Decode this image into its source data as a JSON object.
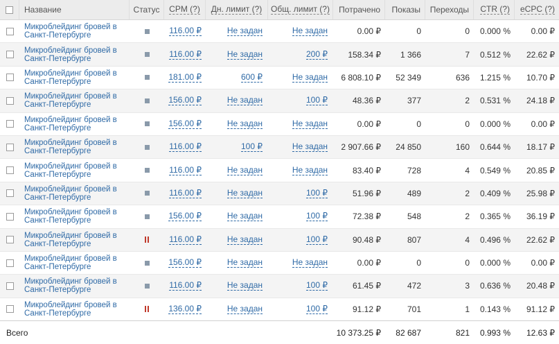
{
  "header": {
    "name": "Название",
    "status": "Статус",
    "cpm": "CPM (?)",
    "daily_limit": "Дн. лимит (?)",
    "total_limit": "Общ. лимит (?)",
    "spent": "Потрачено",
    "views": "Показы",
    "clicks": "Переходы",
    "ctr": "CTR (?)",
    "ecpc": "eCPC (?)"
  },
  "rows": [
    {
      "name": "Микроблейдинг бровей в Санкт-Петербурге",
      "status": "stopped",
      "cpm": "116.00 ₽",
      "daily": "Не задан",
      "total": "Не задан",
      "spent": "0.00 ₽",
      "views": "0",
      "clicks": "0",
      "ctr": "0.000 %",
      "ecpc": "0.00 ₽"
    },
    {
      "name": "Микроблейдинг бровей в Санкт-Петербурге",
      "status": "stopped",
      "cpm": "116.00 ₽",
      "daily": "Не задан",
      "total": "200 ₽",
      "spent": "158.34 ₽",
      "views": "1 366",
      "clicks": "7",
      "ctr": "0.512 %",
      "ecpc": "22.62 ₽"
    },
    {
      "name": "Микроблейдинг бровей в Санкт-Петербурге",
      "status": "stopped",
      "cpm": "181.00 ₽",
      "daily": "600 ₽",
      "total": "Не задан",
      "spent": "6 808.10 ₽",
      "views": "52 349",
      "clicks": "636",
      "ctr": "1.215 %",
      "ecpc": "10.70 ₽"
    },
    {
      "name": "Микроблейдинг бровей в Санкт-Петербурге",
      "status": "stopped",
      "cpm": "156.00 ₽",
      "daily": "Не задан",
      "total": "100 ₽",
      "spent": "48.36 ₽",
      "views": "377",
      "clicks": "2",
      "ctr": "0.531 %",
      "ecpc": "24.18 ₽"
    },
    {
      "name": "Микроблейдинг бровей в Санкт-Петербурге",
      "status": "stopped",
      "cpm": "156.00 ₽",
      "daily": "Не задан",
      "total": "Не задан",
      "spent": "0.00 ₽",
      "views": "0",
      "clicks": "0",
      "ctr": "0.000 %",
      "ecpc": "0.00 ₽"
    },
    {
      "name": "Микроблейдинг бровей в Санкт-Петербурге",
      "status": "stopped",
      "cpm": "116.00 ₽",
      "daily": "100 ₽",
      "total": "Не задан",
      "spent": "2 907.66 ₽",
      "views": "24 850",
      "clicks": "160",
      "ctr": "0.644 %",
      "ecpc": "18.17 ₽"
    },
    {
      "name": "Микроблейдинг бровей в Санкт-Петербурге",
      "status": "stopped",
      "cpm": "116.00 ₽",
      "daily": "Не задан",
      "total": "Не задан",
      "spent": "83.40 ₽",
      "views": "728",
      "clicks": "4",
      "ctr": "0.549 %",
      "ecpc": "20.85 ₽"
    },
    {
      "name": "Микроблейдинг бровей в Санкт-Петербурге",
      "status": "stopped",
      "cpm": "116.00 ₽",
      "daily": "Не задан",
      "total": "100 ₽",
      "spent": "51.96 ₽",
      "views": "489",
      "clicks": "2",
      "ctr": "0.409 %",
      "ecpc": "25.98 ₽"
    },
    {
      "name": "Микроблейдинг бровей в Санкт-Петербурге",
      "status": "stopped",
      "cpm": "156.00 ₽",
      "daily": "Не задан",
      "total": "100 ₽",
      "spent": "72.38 ₽",
      "views": "548",
      "clicks": "2",
      "ctr": "0.365 %",
      "ecpc": "36.19 ₽"
    },
    {
      "name": "Микроблейдинг бровей в Санкт-Петербурге",
      "status": "paused",
      "cpm": "116.00 ₽",
      "daily": "Не задан",
      "total": "100 ₽",
      "spent": "90.48 ₽",
      "views": "807",
      "clicks": "4",
      "ctr": "0.496 %",
      "ecpc": "22.62 ₽"
    },
    {
      "name": "Микроблейдинг бровей в Санкт-Петербурге",
      "status": "stopped",
      "cpm": "156.00 ₽",
      "daily": "Не задан",
      "total": "Не задан",
      "spent": "0.00 ₽",
      "views": "0",
      "clicks": "0",
      "ctr": "0.000 %",
      "ecpc": "0.00 ₽"
    },
    {
      "name": "Микроблейдинг бровей в Санкт-Петербурге",
      "status": "stopped",
      "cpm": "116.00 ₽",
      "daily": "Не задан",
      "total": "100 ₽",
      "spent": "61.45 ₽",
      "views": "472",
      "clicks": "3",
      "ctr": "0.636 %",
      "ecpc": "20.48 ₽"
    },
    {
      "name": "Микроблейдинг бровей в Санкт-Петербурге",
      "status": "paused",
      "cpm": "136.00 ₽",
      "daily": "Не задан",
      "total": "100 ₽",
      "spent": "91.12 ₽",
      "views": "701",
      "clicks": "1",
      "ctr": "0.143 %",
      "ecpc": "91.12 ₽"
    }
  ],
  "footer": {
    "label": "Всего",
    "spent": "10 373.25 ₽",
    "views": "82 687",
    "clicks": "821",
    "ctr": "0.993 %",
    "ecpc": "12.63 ₽"
  },
  "icons": {
    "stopped": "stop-icon",
    "paused": "pause-icon"
  },
  "colors": {
    "link": "#2f6aa6",
    "paused": "#c0392b",
    "stopped": "#8a9aaa"
  }
}
